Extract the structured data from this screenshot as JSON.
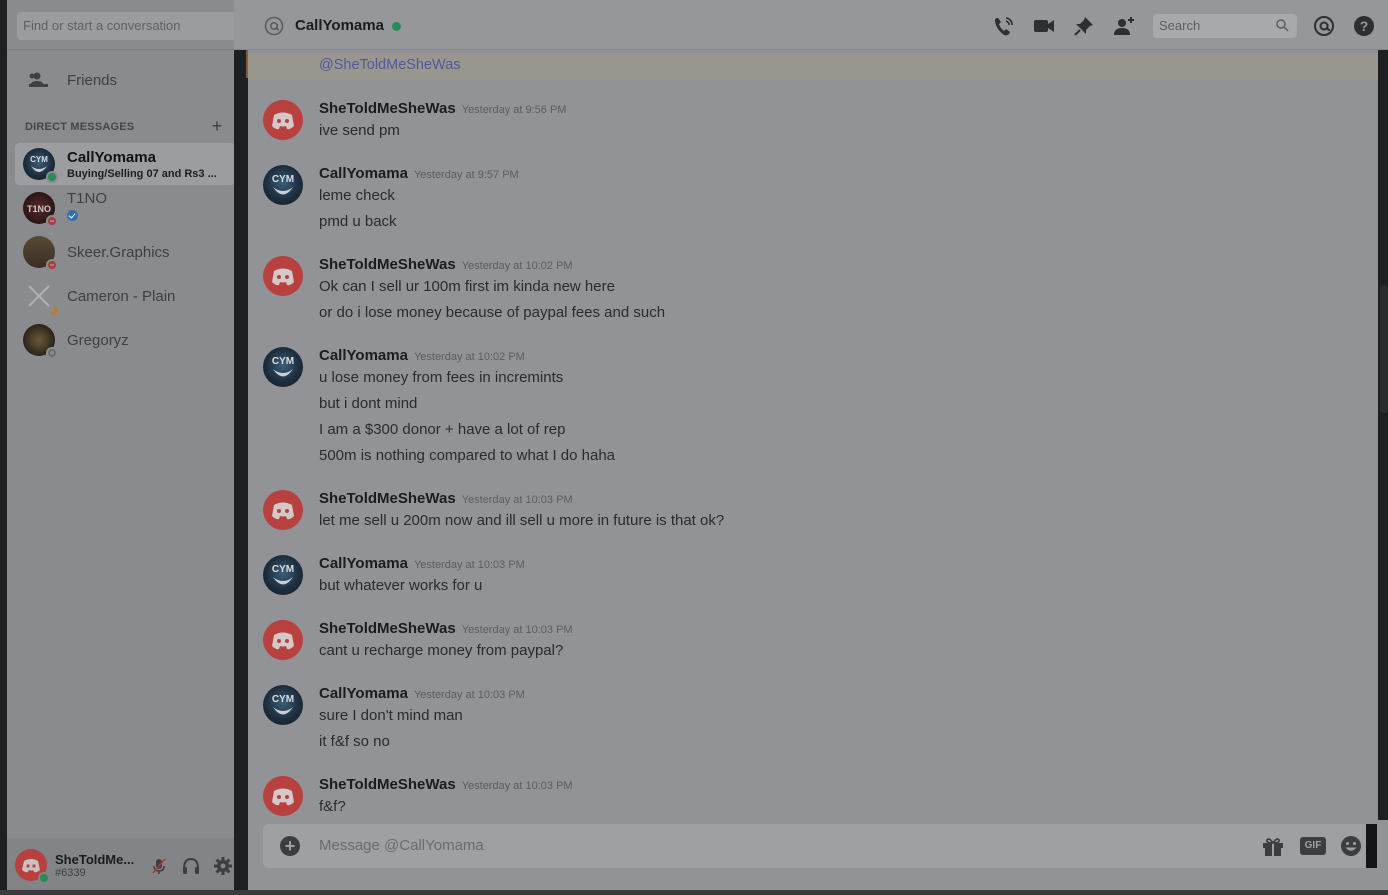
{
  "sidebar": {
    "search_placeholder": "Find or start a conversation",
    "friends_label": "Friends",
    "dm_header": "DIRECT MESSAGES",
    "dm_add": "+",
    "dms": [
      {
        "name": "CallYomama",
        "sub": "Buying/Selling 07 and Rs3 ...",
        "status": "online",
        "active": true
      },
      {
        "name": "T1NO",
        "sub": "",
        "status": "dnd",
        "verified": true
      },
      {
        "name": "Skeer.Graphics",
        "sub": "",
        "status": "dnd"
      },
      {
        "name": "Cameron - Plain",
        "sub": "",
        "status": "idle"
      },
      {
        "name": "Gregoryz",
        "sub": "",
        "status": "offline"
      }
    ]
  },
  "user": {
    "name": "SheToldMe...",
    "tag": "#6339"
  },
  "header": {
    "title": "CallYomama",
    "search_placeholder": "Search"
  },
  "chat": {
    "mention": "@SheToldMeSheWas",
    "messages": [
      {
        "author": "SheToldMeSheWas",
        "time": "Yesterday at 9:56 PM",
        "avatar": "discord",
        "lines": [
          "ive send pm"
        ]
      },
      {
        "author": "CallYomama",
        "time": "Yesterday at 9:57 PM",
        "avatar": "cym",
        "lines": [
          "leme check",
          "pmd u back"
        ]
      },
      {
        "author": "SheToldMeSheWas",
        "time": "Yesterday at 10:02 PM",
        "avatar": "discord",
        "lines": [
          "Ok can I sell ur 100m first im kinda new here",
          "or do i lose money because of paypal fees and such"
        ]
      },
      {
        "author": "CallYomama",
        "time": "Yesterday at 10:02 PM",
        "avatar": "cym",
        "lines": [
          "u lose money from fees in incremints",
          "but i dont mind",
          "I am a $300 donor + have a lot of rep",
          "500m is nothing compared to what I do haha"
        ]
      },
      {
        "author": "SheToldMeSheWas",
        "time": "Yesterday at 10:03 PM",
        "avatar": "discord",
        "lines": [
          "let me sell u 200m now and ill sell u more in future is that ok?"
        ]
      },
      {
        "author": "CallYomama",
        "time": "Yesterday at 10:03 PM",
        "avatar": "cym",
        "lines": [
          "but whatever works for u"
        ]
      },
      {
        "author": "SheToldMeSheWas",
        "time": "Yesterday at 10:03 PM",
        "avatar": "discord",
        "lines": [
          "cant u recharge money from paypal?"
        ]
      },
      {
        "author": "CallYomama",
        "time": "Yesterday at 10:03 PM",
        "avatar": "cym",
        "lines": [
          "sure I don't mind man",
          "it f&f so no"
        ]
      },
      {
        "author": "SheToldMeSheWas",
        "time": "Yesterday at 10:03 PM",
        "avatar": "discord",
        "lines": [
          "f&f?"
        ]
      }
    ]
  },
  "composer": {
    "placeholder": "Message @CallYomama",
    "gif_label": "GIF"
  },
  "colors": {
    "online": "#2a8a58",
    "dnd": "#b03a3b",
    "idle": "#c07a28",
    "mention": "#4f5a9a",
    "discord_avatar": "#b8403f"
  },
  "icons": [
    "phone-icon",
    "video-icon",
    "pin-icon",
    "add-member-icon",
    "search-icon",
    "mention-icon",
    "help-icon",
    "gift-icon",
    "emoji-icon",
    "mute-mic-icon",
    "headphones-icon",
    "gear-icon"
  ]
}
